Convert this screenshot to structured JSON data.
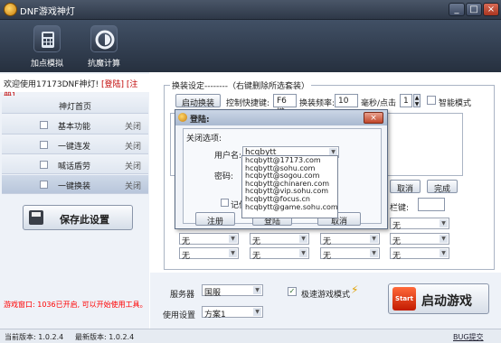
{
  "window": {
    "title": "DNF游戏神灯",
    "min": "_",
    "max": "□",
    "close": "×"
  },
  "toolbar": {
    "items": [
      {
        "label": "加点模拟",
        "icon": "calculator-icon"
      },
      {
        "label": "抗魔计算",
        "icon": "swirl-icon"
      }
    ]
  },
  "sidebar": {
    "welcome": "欢迎使用17173DNF神灯!",
    "login_link": "[登陆]",
    "register_link": "[注册]",
    "home": "神灯首页",
    "items": [
      {
        "label": "基本功能",
        "state": "关闭"
      },
      {
        "label": "一键连发",
        "state": "关闭"
      },
      {
        "label": "喊话盾劳",
        "state": "关闭"
      },
      {
        "label": "一键换装",
        "state": "关闭"
      }
    ],
    "save_label": "保存此设置",
    "status_message": "游戏窗口: 1036已开启, 可以开始使用工具。"
  },
  "swap": {
    "group_label": "换装设定--------（右键删除所选套装）",
    "start_button": "启动换装",
    "hotkey_label": "控制快捷键:",
    "hotkey_value": "F6键",
    "freq_label": "换装频率:",
    "freq_value": "10",
    "freq_unit": "毫秒/点击",
    "step_value": "1",
    "smart_mode": "智能模式",
    "cancel_button": "取消",
    "done_button": "完成",
    "bar_key_label": "栏键:",
    "grid_value": "无"
  },
  "bottom": {
    "server_label": "服务器",
    "server_value": "国服",
    "fast_mode": "极速游戏模式",
    "use_setting_label": "使用设置",
    "use_setting_value": "方案1",
    "start_game": "启动游戏",
    "start_badge": "Start"
  },
  "statusbar": {
    "current": "当前版本: 1.0.2.4",
    "latest": "最新版本: 1.0.2.4",
    "bug": "BUG提交"
  },
  "dialog": {
    "title": "登陆:",
    "close": "×",
    "close_options": "关闭选项:",
    "username_label": "用户名:",
    "username_value": "hcqbytt",
    "password_label": "密码:",
    "remember": "记住",
    "register_button": "注册",
    "login_button": "登陆",
    "cancel_button": "取消",
    "suggestions": [
      "hcqbytt@17173.com",
      "hcqbytt@sohu.com",
      "hcqbytt@sogou.com",
      "hcqbytt@chinaren.com",
      "hcqbytt@vip.sohu.com",
      "hcqbytt@focus.cn",
      "hcqbytt@game.sohu.com"
    ]
  }
}
